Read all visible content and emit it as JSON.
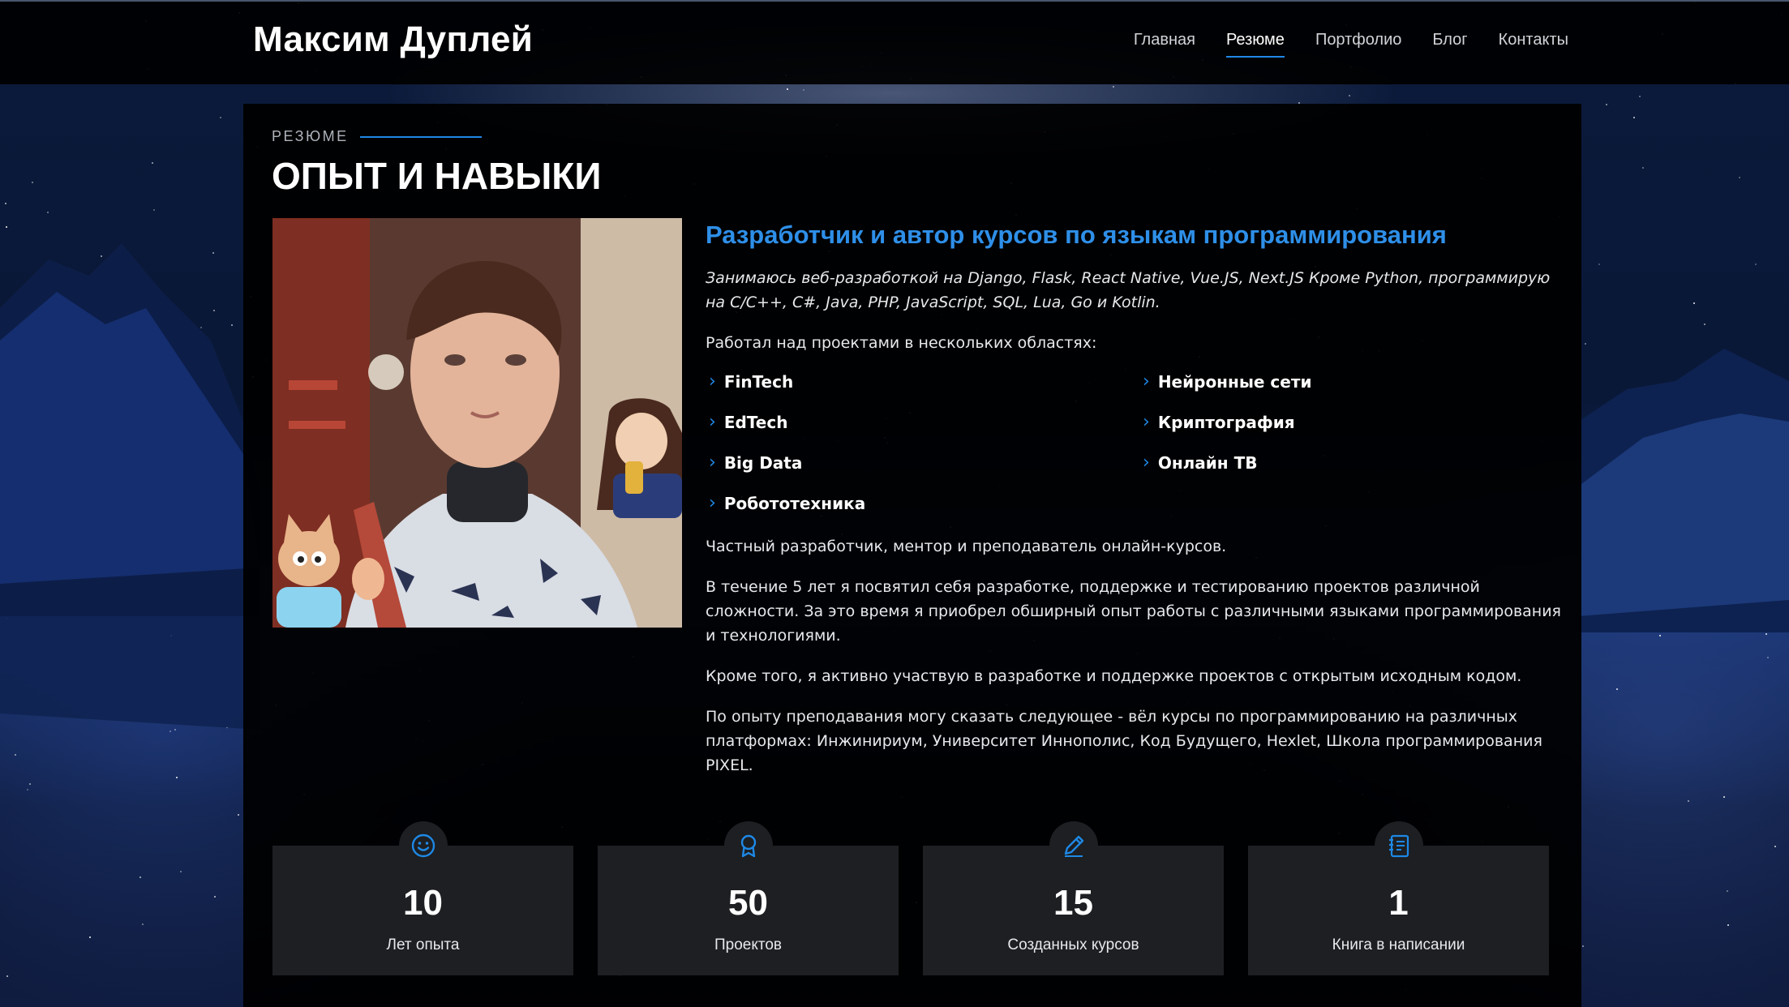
{
  "header": {
    "logo": "Максим Дуплей",
    "nav": [
      {
        "label": "Главная",
        "active": false
      },
      {
        "label": "Резюме",
        "active": true
      },
      {
        "label": "Портфолио",
        "active": false
      },
      {
        "label": "Блог",
        "active": false
      },
      {
        "label": "Контакты",
        "active": false
      }
    ]
  },
  "section": {
    "label": "РЕЗЮМЕ",
    "title": "ОПЫТ И НАВЫКИ"
  },
  "profile": {
    "job_title": "Разработчик и автор курсов по языкам программирования",
    "intro": "Занимаюсь веб-разработкой на Django, Flask, React Native, Vue.JS, Next.JS Кроме Python, программирую на C/C++, C#, Java, PHP, JavaScript, SQL, Lua, Go и Kotlin.",
    "areas_heading": "Работал над проектами в нескольких областях:",
    "areas": [
      "FinTech",
      "Нейронные сети",
      "EdTech",
      "Криптография",
      "Big Data",
      "Онлайн ТВ",
      "Робототехника"
    ],
    "para1": "Частный разработчик, ментор и преподаватель онлайн-курсов.",
    "para2": "В течение 5 лет я посвятил себя разработке, поддержке и тестированию проектов различной сложности. За это время я приобрел обширный опыт работы с различными языками программирования и технологиями.",
    "para3": "Кроме того, я активно участвую в разработке и поддержке проектов с открытым исходным кодом.",
    "para4": "По опыту преподавания могу сказать следующее - вёл курсы по программированию на различных платформах: Инжинириум, Университет Иннополис, Код Будущего, Hexlet, Школа программирования PIXEL."
  },
  "counts": [
    {
      "icon": "smile-icon",
      "value": "10",
      "label": "Лет опыта"
    },
    {
      "icon": "award-icon",
      "value": "50",
      "label": "Проектов"
    },
    {
      "icon": "pencil-icon",
      "value": "15",
      "label": "Созданных курсов"
    },
    {
      "icon": "journal-icon",
      "value": "1",
      "label": "Книга в написании"
    }
  ],
  "colors": {
    "accent": "#1e88e5",
    "title_blue": "#2e8fe8",
    "panel": "#000000",
    "count_box": "#1d1f22"
  }
}
